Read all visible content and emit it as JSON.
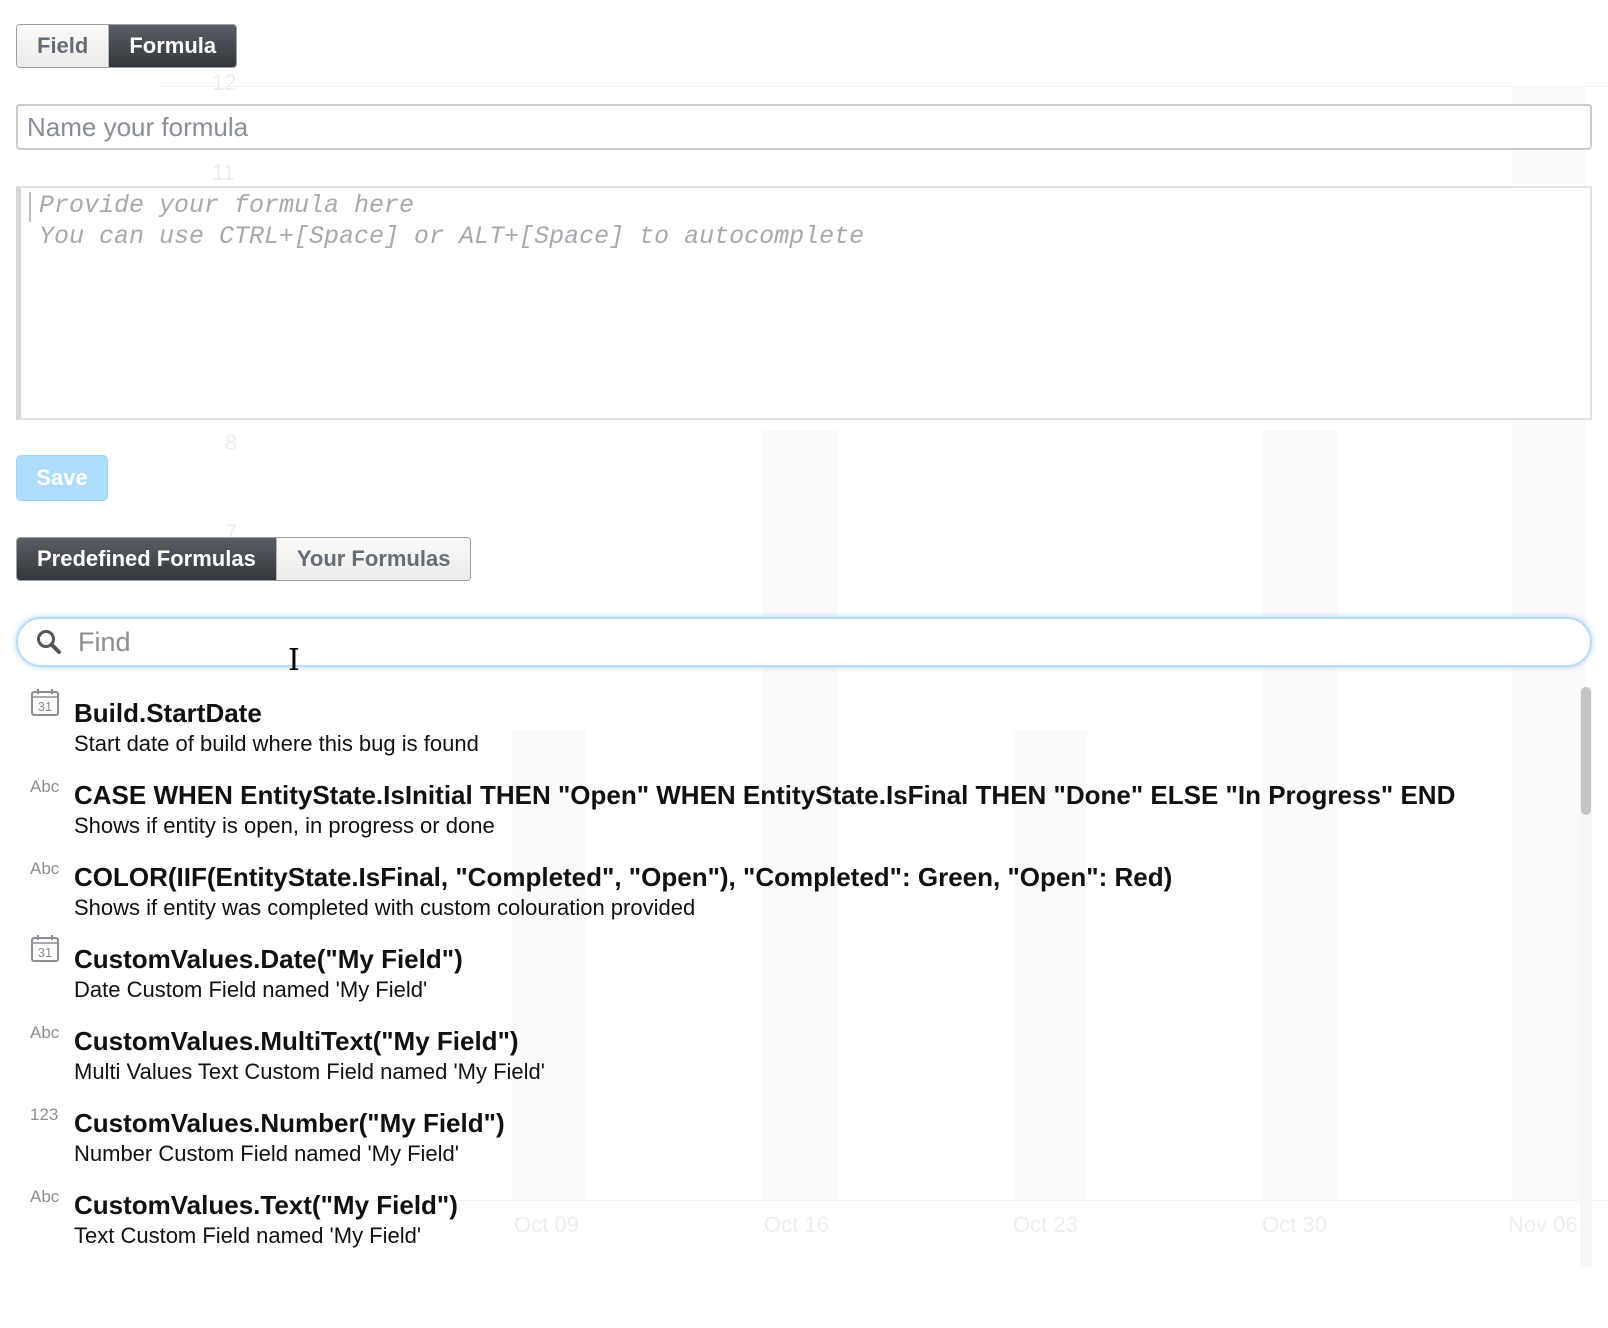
{
  "mode_toggle": {
    "field_label": "Field",
    "formula_label": "Formula",
    "active": "Formula"
  },
  "formula_name": {
    "placeholder": "Name your formula",
    "value": ""
  },
  "formula_editor": {
    "placeholder_line1": "Provide your formula here",
    "placeholder_line2": "You can use CTRL+[Space] or ALT+[Space] to autocomplete"
  },
  "save_label": "Save",
  "formula_tabs": {
    "predefined_label": "Predefined Formulas",
    "yours_label": "Your Formulas",
    "active": "Predefined Formulas"
  },
  "search": {
    "placeholder": "Find",
    "value": "",
    "icon": "search-icon"
  },
  "formulas": [
    {
      "type": "date",
      "type_label": "31",
      "title": "Build.StartDate",
      "description": "Start date of build where this bug is found"
    },
    {
      "type": "text",
      "type_label": "Abc",
      "title": "CASE  WHEN EntityState.IsInitial THEN \"Open\"  WHEN EntityState.IsFinal THEN \"Done\"  ELSE \"In Progress\"  END",
      "description": "Shows if entity is open, in progress or done"
    },
    {
      "type": "text",
      "type_label": "Abc",
      "title": "COLOR(IIF(EntityState.IsFinal, \"Completed\", \"Open\"), \"Completed\": Green, \"Open\": Red)",
      "description": "Shows if entity was completed with custom colouration provided"
    },
    {
      "type": "date",
      "type_label": "31",
      "title": "CustomValues.Date(\"My Field\")",
      "description": "Date Custom Field named 'My Field'"
    },
    {
      "type": "text",
      "type_label": "Abc",
      "title": "CustomValues.MultiText(\"My Field\")",
      "description": "Multi Values Text Custom Field named 'My Field'"
    },
    {
      "type": "number",
      "type_label": "123",
      "title": "CustomValues.Number(\"My Field\")",
      "description": "Number Custom Field named 'My Field'"
    },
    {
      "type": "text",
      "type_label": "Abc",
      "title": "CustomValues.Text(\"My Field\")",
      "description": "Text Custom Field named 'My Field'"
    }
  ],
  "background": {
    "y_ticks": [
      "12",
      "11",
      "8",
      "7"
    ],
    "x_ticks": [
      "Oct 09",
      "Oct 16",
      "Oct 23",
      "Oct 30",
      "Nov 06"
    ]
  },
  "colors": {
    "active_tab": "#3f4349",
    "save_disabled": "#aedcfb",
    "search_focus": "#b8dcf6"
  }
}
